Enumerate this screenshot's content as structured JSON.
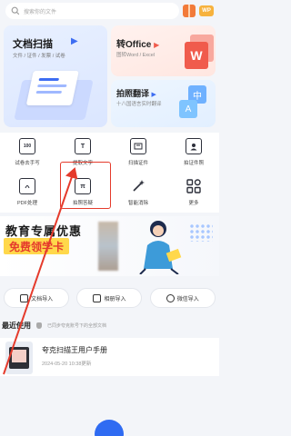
{
  "top": {
    "search_placeholder": "搜索你的文件",
    "badge": "WP"
  },
  "cards": {
    "doc_scan": {
      "title": "文档扫描",
      "subtitle": "文件 / 证件 / 发票 / 试卷",
      "arrow": "▶"
    },
    "to_office": {
      "title": "转Office",
      "subtitle": "图转Word / Excel",
      "arrow": "▶",
      "icon": "W"
    },
    "photo_translate": {
      "title": "拍照翻译",
      "subtitle": "十八国语言实时翻译",
      "arrow": "▶",
      "icon_zh": "中",
      "icon_a": "A"
    }
  },
  "tools": [
    {
      "label": "试卷去手写",
      "glyph": "100"
    },
    {
      "label": "提取文字",
      "glyph": "T"
    },
    {
      "label": "扫描证件",
      "glyph": ""
    },
    {
      "label": "拍证件照",
      "glyph": ""
    },
    {
      "label": "PDF处理",
      "glyph": ""
    },
    {
      "label": "拍照答疑",
      "glyph": "π"
    },
    {
      "label": "智能消除",
      "glyph": ""
    },
    {
      "label": "更多",
      "glyph": ""
    }
  ],
  "banner": {
    "line1": "教育专属优惠",
    "line2": "免费领学卡"
  },
  "imports": [
    {
      "label": "文档导入"
    },
    {
      "label": "相册导入"
    },
    {
      "label": "微信导入"
    }
  ],
  "recent": {
    "title": "最近使用",
    "hint": "已同步夸克账号下的全部文档"
  },
  "file": {
    "name": "夸克扫描王用户手册",
    "time": "2024-05-20 10:38更新"
  },
  "colors": {
    "accent": "#2f6bf2",
    "highlight": "#e53b2c"
  }
}
